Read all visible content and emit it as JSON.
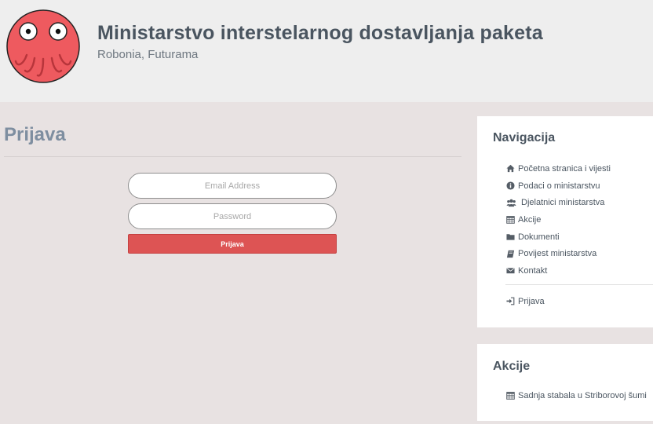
{
  "header": {
    "title": "Ministarstvo interstelarnog dostavljanja paketa",
    "subtitle": "Robonia, Futurama",
    "logo_icon": "octopus-logo-icon",
    "logo_color": "#ee5a5f"
  },
  "main": {
    "title": "Prijava",
    "email_placeholder": "Email Address",
    "password_placeholder": "Password",
    "email_value": "",
    "password_value": "",
    "login_label": "Prijava",
    "button_color": "#dd5454"
  },
  "sidebar": {
    "navigation": {
      "title": "Navigacija",
      "items": [
        {
          "label": "Početna stranica i vijesti",
          "icon": "home-icon"
        },
        {
          "label": "Podaci o ministarstvu",
          "icon": "info-icon"
        },
        {
          "label": "Djelatnici ministarstva",
          "icon": "users-icon"
        },
        {
          "label": "Akcije",
          "icon": "calendar-icon"
        },
        {
          "label": "Dokumenti",
          "icon": "folder-icon"
        },
        {
          "label": "Povijest ministarstva",
          "icon": "book-icon"
        },
        {
          "label": "Kontakt",
          "icon": "envelope-icon"
        }
      ],
      "login_item": {
        "label": "Prijava",
        "icon": "sign-in-icon"
      }
    },
    "events": {
      "title": "Akcije",
      "items": [
        {
          "label": "Sadnja stabala u Striborovoj šumi",
          "icon": "calendar-icon"
        }
      ]
    }
  }
}
